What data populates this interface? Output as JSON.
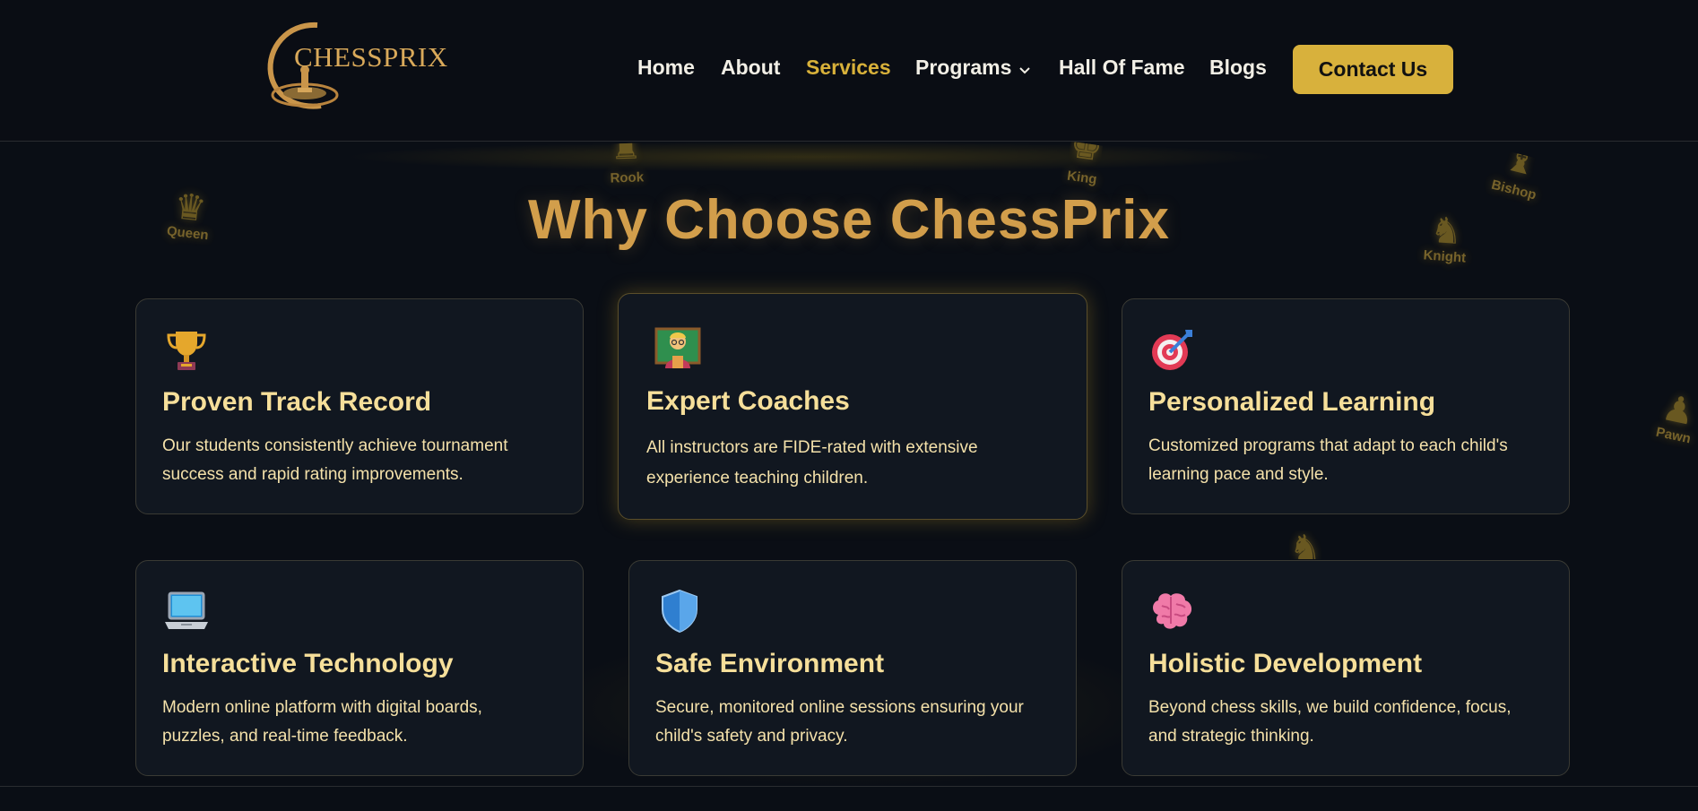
{
  "brand": {
    "name": "CHESSPRIX"
  },
  "nav": {
    "items": [
      "Home",
      "About",
      "Services",
      "Programs",
      "Hall Of Fame",
      "Blogs"
    ],
    "active": "Services",
    "contact_label": "Contact Us"
  },
  "hero": {
    "title": "Why Choose ChessPrix",
    "pieces": [
      "Queen",
      "Rook",
      "King",
      "Bishop",
      "Knight",
      "Pawn"
    ]
  },
  "cards": [
    {
      "icon": "trophy-icon",
      "title": "Proven Track Record",
      "desc": "Our students consistently achieve tournament success and rapid rating improvements."
    },
    {
      "icon": "teacher-icon",
      "title": "Expert Coaches",
      "desc": "All instructors are FIDE-rated with extensive experience teaching children."
    },
    {
      "icon": "target-icon",
      "title": "Personalized Learning",
      "desc": "Customized programs that adapt to each child's learning pace and style."
    },
    {
      "icon": "laptop-icon",
      "title": "Interactive Technology",
      "desc": "Modern online platform with digital boards, puzzles, and real-time feedback."
    },
    {
      "icon": "shield-icon",
      "title": "Safe Environment",
      "desc": "Secure, monitored online sessions ensuring your child's safety and privacy."
    },
    {
      "icon": "brain-icon",
      "title": "Holistic Development",
      "desc": "Beyond chess skills, we build confidence, focus, and strategic thinking."
    }
  ],
  "colors": {
    "accent_gold": "#d8b13c",
    "title_gold": "#d29e4b",
    "card_bg": "#111720",
    "page_bg": "#0a0e15"
  }
}
